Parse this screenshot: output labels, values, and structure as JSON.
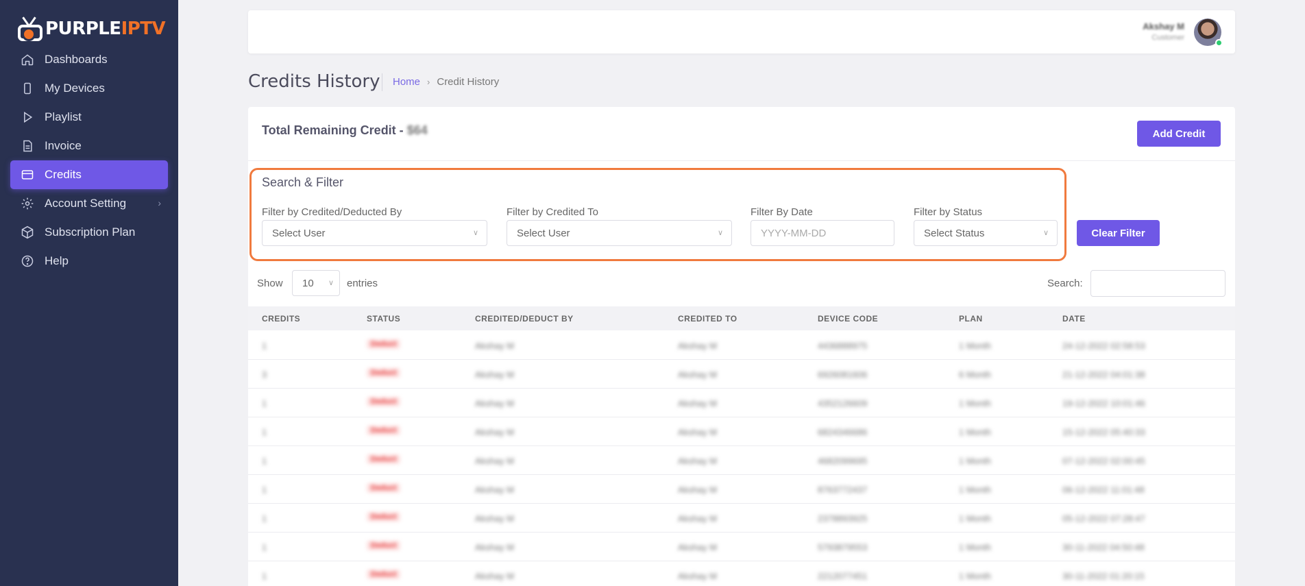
{
  "brand": {
    "name_main": "PURPLE",
    "name_accent": "IPTV"
  },
  "sidebar": {
    "items": [
      {
        "label": "Dashboards",
        "icon": "home-icon"
      },
      {
        "label": "My Devices",
        "icon": "device-icon"
      },
      {
        "label": "Playlist",
        "icon": "play-icon"
      },
      {
        "label": "Invoice",
        "icon": "invoice-icon"
      },
      {
        "label": "Credits",
        "icon": "credit-card-icon",
        "active": true
      },
      {
        "label": "Account Setting",
        "icon": "gear-icon",
        "has_submenu": true
      },
      {
        "label": "Subscription Plan",
        "icon": "box-icon"
      },
      {
        "label": "Help",
        "icon": "help-icon"
      }
    ]
  },
  "header": {
    "user_name": "Akshay M",
    "user_role": "Customer"
  },
  "page": {
    "title": "Credits History",
    "breadcrumb_home": "Home",
    "breadcrumb_current": "Credit History"
  },
  "credits": {
    "total_label": "Total Remaining Credit - ",
    "total_amount": "$64",
    "add_button": "Add Credit"
  },
  "filter": {
    "title": "Search & Filter",
    "by_credited_label": "Filter by Credited/Deducted By",
    "by_credited_value": "Select User",
    "to_label": "Filter by Credited To",
    "to_value": "Select User",
    "date_label": "Filter By Date",
    "date_placeholder": "YYYY-MM-DD",
    "status_label": "Filter by Status",
    "status_value": "Select Status",
    "clear_button": "Clear Filter"
  },
  "table_controls": {
    "show_label": "Show",
    "page_length": "10",
    "entries_label": "entries",
    "search_label": "Search:"
  },
  "table": {
    "columns": [
      "CREDITS",
      "STATUS",
      "CREDITED/DEDUCT BY",
      "CREDITED TO",
      "DEVICE CODE",
      "PLAN",
      "DATE"
    ],
    "rows": [
      [
        "1",
        "Deduct",
        "Akshay M",
        "Akshay M",
        "4436888975",
        "1 Month",
        "24-12-2022 02:58:53"
      ],
      [
        "3",
        "Deduct",
        "Akshay M",
        "Akshay M",
        "6926081606",
        "6 Month",
        "21-12-2022 04:01:38"
      ],
      [
        "1",
        "Deduct",
        "Akshay M",
        "Akshay M",
        "4352126609",
        "1 Month",
        "19-12-2022 10:01:46"
      ],
      [
        "1",
        "Deduct",
        "Akshay M",
        "Akshay M",
        "6824346686",
        "1 Month",
        "15-12-2022 05:40:33"
      ],
      [
        "1",
        "Deduct",
        "Akshay M",
        "Akshay M",
        "4682099695",
        "1 Month",
        "07-12-2022 02:00:45"
      ],
      [
        "1",
        "Deduct",
        "Akshay M",
        "Akshay M",
        "8763772437",
        "1 Month",
        "06-12-2022 11:01:48"
      ],
      [
        "1",
        "Deduct",
        "Akshay M",
        "Akshay M",
        "2378893925",
        "1 Month",
        "05-12-2022 07:28:47"
      ],
      [
        "1",
        "Deduct",
        "Akshay M",
        "Akshay M",
        "5793879553",
        "1 Month",
        "30-11-2022 04:50:48"
      ],
      [
        "1",
        "Deduct",
        "Akshay M",
        "Akshay M",
        "2212077451",
        "1 Month",
        "30-11-2022 01:20:15"
      ]
    ]
  },
  "colors": {
    "sidebar_bg": "#293150",
    "accent": "#6f58e6",
    "brand_orange": "#f07127",
    "highlight_border": "#f07a3e",
    "status_deduct": "#e53b3b"
  }
}
